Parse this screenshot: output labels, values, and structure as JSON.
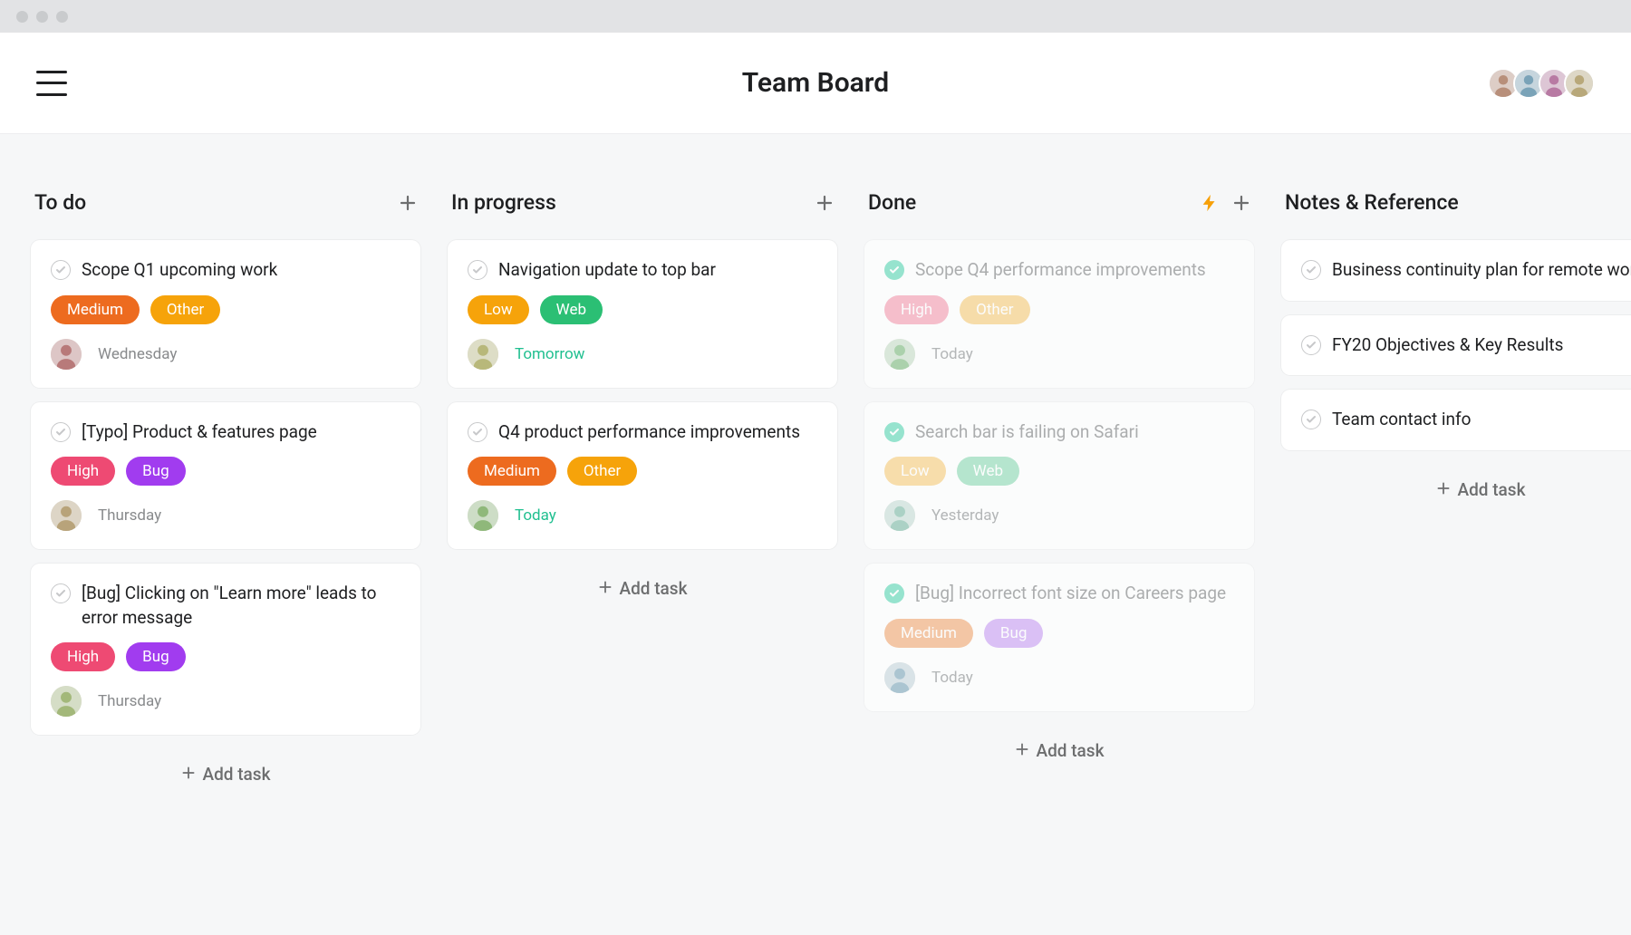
{
  "header": {
    "title": "Team Board",
    "collaborators": 4
  },
  "colors": {
    "tagColors": {
      "High": "#ee4a73",
      "Medium": "#ed6b1f",
      "Low": "#f6a30a",
      "Bug": "#a13cef",
      "Web": "#2bbf74",
      "Other": "#f6a30a"
    },
    "fadedTagColors": {
      "High": "#f598ae",
      "Medium": "#f2a56f",
      "Low": "#f9cc79",
      "Bug": "#c99cf3",
      "Web": "#8bd9b2",
      "Other": "#f7ca76"
    }
  },
  "columns": [
    {
      "title": "To do",
      "showBolt": false,
      "addTaskLabel": "Add task",
      "cards": [
        {
          "title": "Scope Q1 upcoming work",
          "done": false,
          "tags": [
            "Medium",
            "Other"
          ],
          "due": "Wednesday",
          "dueGreen": false,
          "hasAssignee": true
        },
        {
          "title": "[Typo] Product & features page",
          "done": false,
          "tags": [
            "High",
            "Bug"
          ],
          "due": "Thursday",
          "dueGreen": false,
          "hasAssignee": true
        },
        {
          "title": "[Bug] Clicking on \"Learn more\" leads to error message",
          "done": false,
          "tags": [
            "High",
            "Bug"
          ],
          "due": "Thursday",
          "dueGreen": false,
          "hasAssignee": true
        }
      ]
    },
    {
      "title": "In progress",
      "showBolt": false,
      "addTaskLabel": "Add task",
      "cards": [
        {
          "title": "Navigation update to top bar",
          "done": false,
          "tags": [
            "Low",
            "Web"
          ],
          "due": "Tomorrow",
          "dueGreen": true,
          "hasAssignee": true
        },
        {
          "title": "Q4 product performance improvements",
          "done": false,
          "tags": [
            "Medium",
            "Other"
          ],
          "due": "Today",
          "dueGreen": true,
          "hasAssignee": true
        }
      ]
    },
    {
      "title": "Done",
      "showBolt": true,
      "addTaskLabel": "Add task",
      "cards": [
        {
          "title": "Scope Q4 performance improvements",
          "done": true,
          "tags": [
            "High",
            "Other"
          ],
          "due": "Today",
          "dueGreen": false,
          "hasAssignee": true
        },
        {
          "title": "Search bar is failing on Safari",
          "done": true,
          "tags": [
            "Low",
            "Web"
          ],
          "due": "Yesterday",
          "dueGreen": false,
          "hasAssignee": true
        },
        {
          "title": "[Bug] Incorrect font size on Careers page",
          "done": true,
          "tags": [
            "Medium",
            "Bug"
          ],
          "due": "Today",
          "dueGreen": false,
          "hasAssignee": true
        }
      ]
    },
    {
      "title": "Notes & Reference",
      "showBolt": false,
      "addTaskLabel": "Add task",
      "cards": [
        {
          "title": "Business continuity plan for remote work",
          "done": false,
          "tags": [],
          "due": "",
          "dueGreen": false,
          "hasAssignee": false
        },
        {
          "title": "FY20 Objectives & Key Results",
          "done": false,
          "tags": [],
          "due": "",
          "dueGreen": false,
          "hasAssignee": false
        },
        {
          "title": "Team contact info",
          "done": false,
          "tags": [],
          "due": "",
          "dueGreen": false,
          "hasAssignee": false
        }
      ]
    }
  ]
}
